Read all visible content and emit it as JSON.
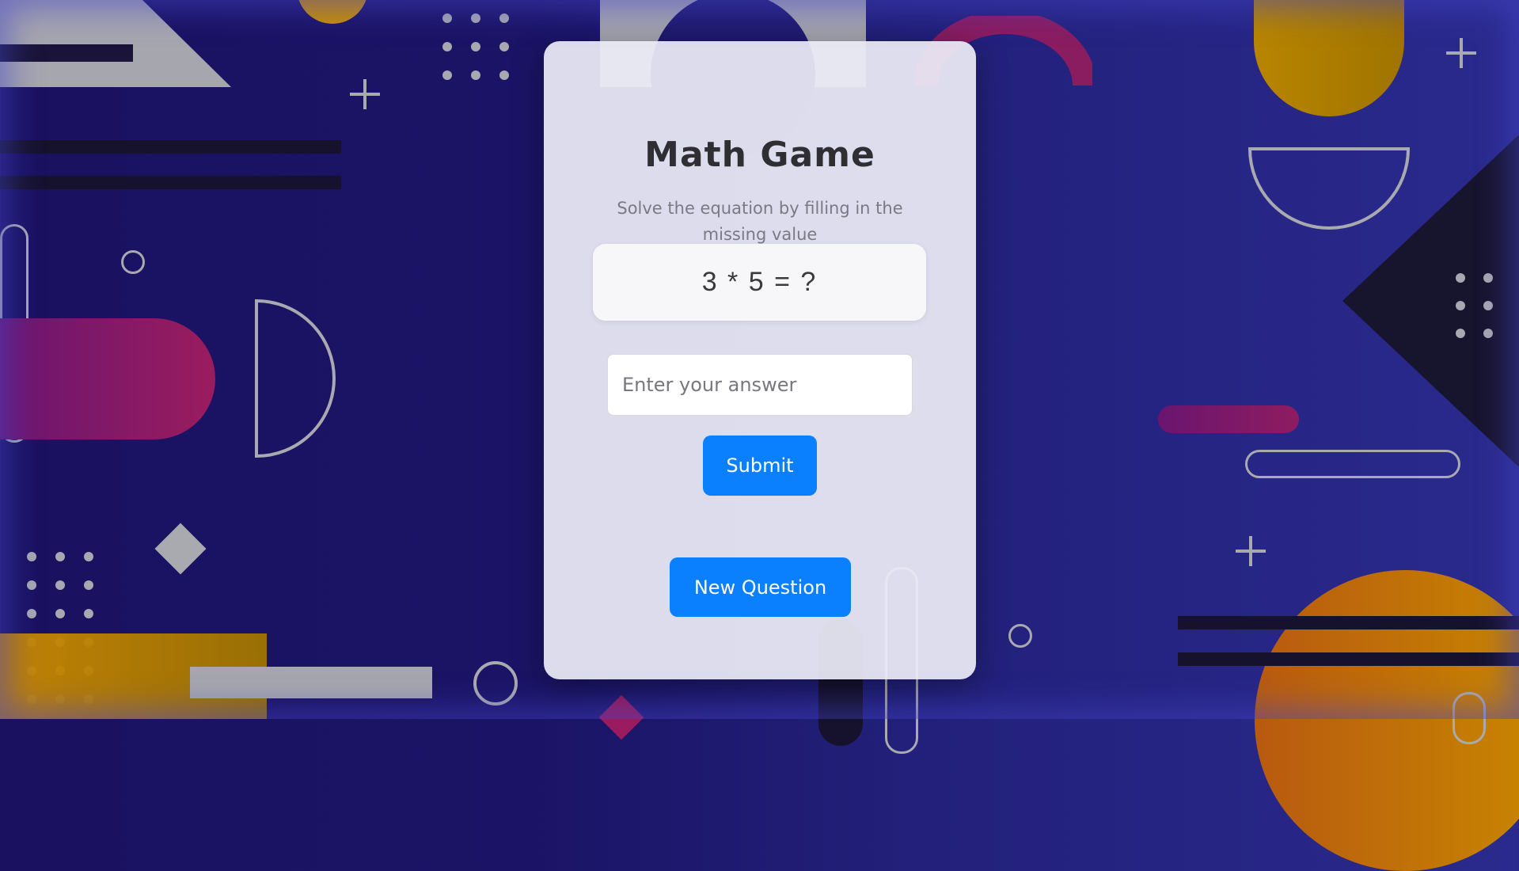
{
  "card": {
    "title": "Math Game",
    "subtitle": "Solve the equation by filling in the missing value",
    "equation": "3 * 5 = ?",
    "answer_placeholder": "Enter your answer",
    "answer_value": "",
    "submit_label": "Submit",
    "new_question_label": "New Question"
  },
  "colors": {
    "accent_button": "#0a80ff",
    "background": "#1b1466",
    "card": "#ececf6",
    "shape_yellow": "#d49a00",
    "shape_magenta": "#b0206a",
    "shape_gray": "#a9a9b0"
  }
}
